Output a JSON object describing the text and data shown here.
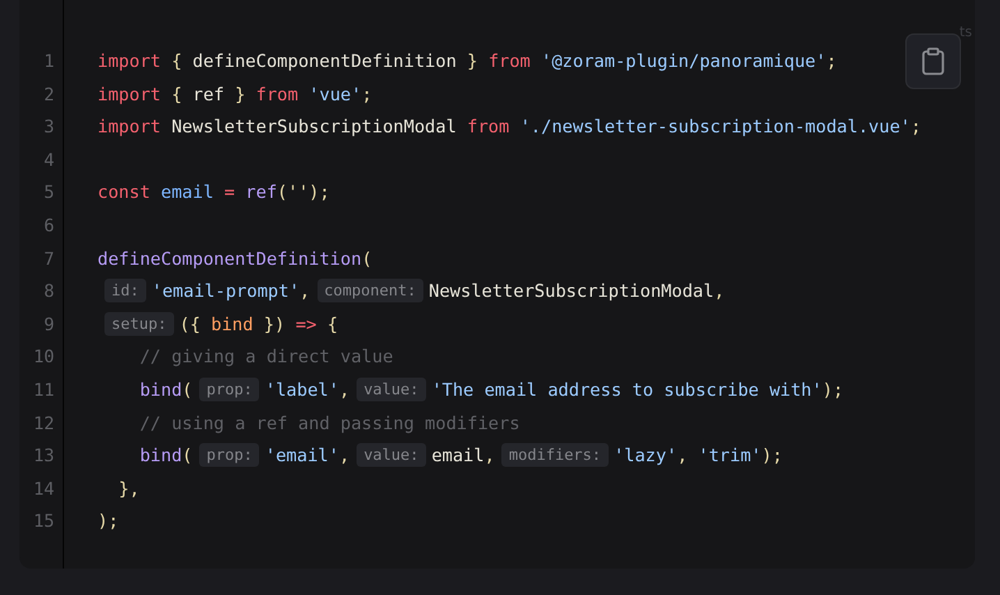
{
  "code_block": {
    "language": "ts",
    "lines": [
      {
        "number": "1",
        "tokens": [
          {
            "kind": "kw",
            "text": "import"
          },
          {
            "kind": "punct",
            "text": " { "
          },
          {
            "kind": "ident",
            "text": "defineComponentDefinition"
          },
          {
            "kind": "punct",
            "text": " } "
          },
          {
            "kind": "kw",
            "text": "from"
          },
          {
            "kind": "str",
            "text": " '@zoram-plugin/panoramique'"
          },
          {
            "kind": "punct",
            "text": ";"
          }
        ]
      },
      {
        "number": "2",
        "tokens": [
          {
            "kind": "kw",
            "text": "import"
          },
          {
            "kind": "punct",
            "text": " { "
          },
          {
            "kind": "ident",
            "text": "ref"
          },
          {
            "kind": "punct",
            "text": " } "
          },
          {
            "kind": "kw",
            "text": "from"
          },
          {
            "kind": "str",
            "text": " 'vue'"
          },
          {
            "kind": "punct",
            "text": ";"
          }
        ]
      },
      {
        "number": "3",
        "tokens": [
          {
            "kind": "kw",
            "text": "import"
          },
          {
            "kind": "ident",
            "text": " NewsletterSubscriptionModal "
          },
          {
            "kind": "kw",
            "text": "from"
          },
          {
            "kind": "str",
            "text": " './newsletter-subscription-modal.vue'"
          },
          {
            "kind": "punct",
            "text": ";"
          }
        ]
      },
      {
        "number": "4"
      },
      {
        "number": "5",
        "tokens": [
          {
            "kind": "kw",
            "text": "const"
          },
          {
            "kind": "var",
            "text": " email"
          },
          {
            "kind": "op",
            "text": " = "
          },
          {
            "kind": "fn",
            "text": "ref"
          },
          {
            "kind": "punct",
            "text": "('');"
          }
        ]
      },
      {
        "number": "6"
      },
      {
        "number": "7",
        "tokens": [
          {
            "kind": "fn",
            "text": "defineComponentDefinition"
          },
          {
            "kind": "punct",
            "text": "("
          }
        ]
      },
      {
        "number": "8",
        "tokens": [
          {
            "kind": "hint",
            "text": "id:"
          },
          {
            "kind": "str",
            "text": "'email-prompt'"
          },
          {
            "kind": "punct",
            "text": ","
          },
          {
            "kind": "hint",
            "text": "component:"
          },
          {
            "kind": "ident",
            "text": "NewsletterSubscriptionModal"
          },
          {
            "kind": "punct",
            "text": ","
          }
        ]
      },
      {
        "number": "9",
        "tokens": [
          {
            "kind": "hint",
            "text": "setup:"
          },
          {
            "kind": "punct",
            "text": "({ "
          },
          {
            "kind": "param",
            "text": "bind"
          },
          {
            "kind": "punct",
            "text": " }) "
          },
          {
            "kind": "op",
            "text": "=>"
          },
          {
            "kind": "punct",
            "text": " {"
          }
        ]
      },
      {
        "number": "10",
        "tokens": [
          {
            "kind": "comment",
            "text": "    // giving a direct value"
          }
        ]
      },
      {
        "number": "11",
        "tokens": [
          {
            "kind": "fn",
            "text": "    bind"
          },
          {
            "kind": "punct",
            "text": "("
          },
          {
            "kind": "hint",
            "text": "prop:"
          },
          {
            "kind": "str",
            "text": "'label'"
          },
          {
            "kind": "punct",
            "text": ","
          },
          {
            "kind": "hint",
            "text": "value:"
          },
          {
            "kind": "str",
            "text": "'The email address to subscribe with'"
          },
          {
            "kind": "punct",
            "text": ");"
          }
        ]
      },
      {
        "number": "12",
        "tokens": [
          {
            "kind": "comment",
            "text": "    // using a ref and passing modifiers"
          }
        ]
      },
      {
        "number": "13",
        "tokens": [
          {
            "kind": "fn",
            "text": "    bind"
          },
          {
            "kind": "punct",
            "text": "("
          },
          {
            "kind": "hint",
            "text": "prop:"
          },
          {
            "kind": "str",
            "text": "'email'"
          },
          {
            "kind": "punct",
            "text": ","
          },
          {
            "kind": "hint",
            "text": "value:"
          },
          {
            "kind": "ident",
            "text": "email"
          },
          {
            "kind": "punct",
            "text": ","
          },
          {
            "kind": "hint",
            "text": "modifiers:"
          },
          {
            "kind": "str",
            "text": "'lazy'"
          },
          {
            "kind": "punct",
            "text": ", "
          },
          {
            "kind": "str",
            "text": "'trim'"
          },
          {
            "kind": "punct",
            "text": ");"
          }
        ]
      },
      {
        "number": "14",
        "tokens": [
          {
            "kind": "punct",
            "text": "  },"
          }
        ]
      },
      {
        "number": "15",
        "tokens": [
          {
            "kind": "punct",
            "text": ");"
          }
        ]
      }
    ]
  }
}
